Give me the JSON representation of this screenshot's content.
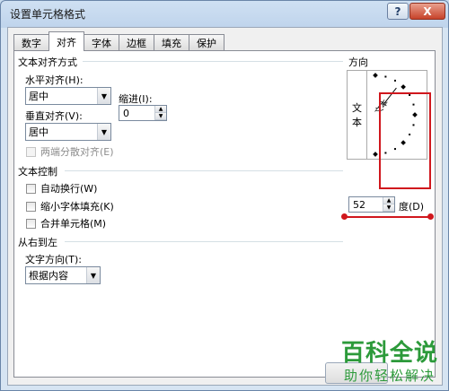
{
  "window": {
    "title": "设置单元格格式",
    "help_label": "?",
    "close_label": "X"
  },
  "tabs": [
    {
      "label": "数字",
      "active": false
    },
    {
      "label": "对齐",
      "active": true
    },
    {
      "label": "字体",
      "active": false
    },
    {
      "label": "边框",
      "active": false
    },
    {
      "label": "填充",
      "active": false
    },
    {
      "label": "保护",
      "active": false
    }
  ],
  "alignment": {
    "group_title": "文本对齐方式",
    "horizontal_label": "水平对齐(H):",
    "horizontal_value": "居中",
    "indent_label": "缩进(I):",
    "indent_value": "0",
    "vertical_label": "垂直对齐(V):",
    "vertical_value": "居中",
    "distributed_label": "两端分散对齐(E)"
  },
  "text_control": {
    "group_title": "文本控制",
    "wrap_label": "自动换行(W)",
    "shrink_label": "缩小字体填充(K)",
    "merge_label": "合并单元格(M)"
  },
  "rtl": {
    "group_title": "从右到左",
    "direction_label": "文字方向(T):",
    "direction_value": "根据内容"
  },
  "orientation": {
    "group_title": "方向",
    "vertical_text_1": "文",
    "vertical_text_2": "本",
    "needle_text": "文本",
    "degrees_value": "52",
    "degrees_label": "度(D)",
    "angle_degrees": 52
  },
  "watermark": {
    "main": "百科全说",
    "sub": "助你轻松解决"
  },
  "colors": {
    "highlight_red": "#d0171d",
    "watermark_green": "#2c9a3a"
  }
}
